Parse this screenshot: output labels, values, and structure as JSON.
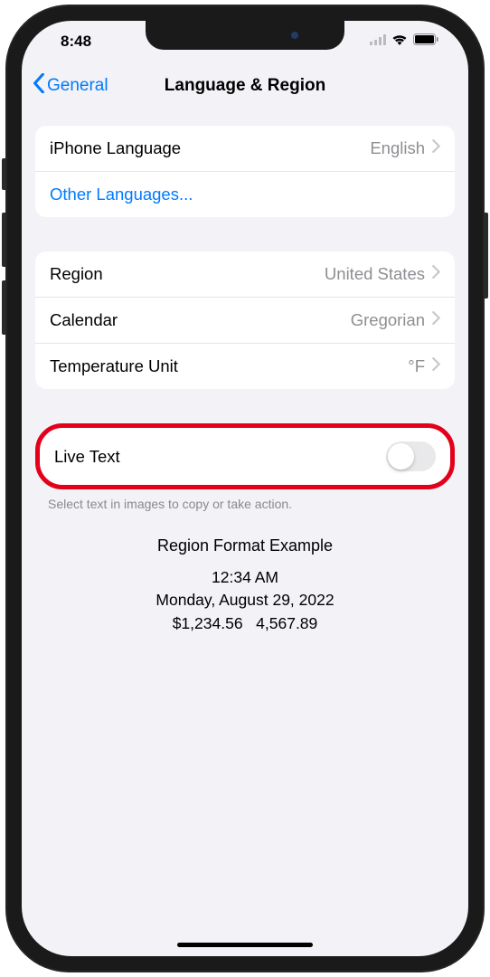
{
  "statusBar": {
    "time": "8:48"
  },
  "nav": {
    "backLabel": "General",
    "title": "Language & Region"
  },
  "group1": {
    "iphoneLanguage": {
      "label": "iPhone Language",
      "value": "English"
    },
    "otherLanguages": {
      "label": "Other Languages..."
    }
  },
  "group2": {
    "region": {
      "label": "Region",
      "value": "United States"
    },
    "calendar": {
      "label": "Calendar",
      "value": "Gregorian"
    },
    "temperature": {
      "label": "Temperature Unit",
      "value": "°F"
    }
  },
  "liveText": {
    "label": "Live Text",
    "enabled": false,
    "footer": "Select text in images to copy or take action."
  },
  "example": {
    "title": "Region Format Example",
    "time": "12:34 AM",
    "date": "Monday, August 29, 2022",
    "currency": "$1,234.56",
    "number": "4,567.89"
  }
}
